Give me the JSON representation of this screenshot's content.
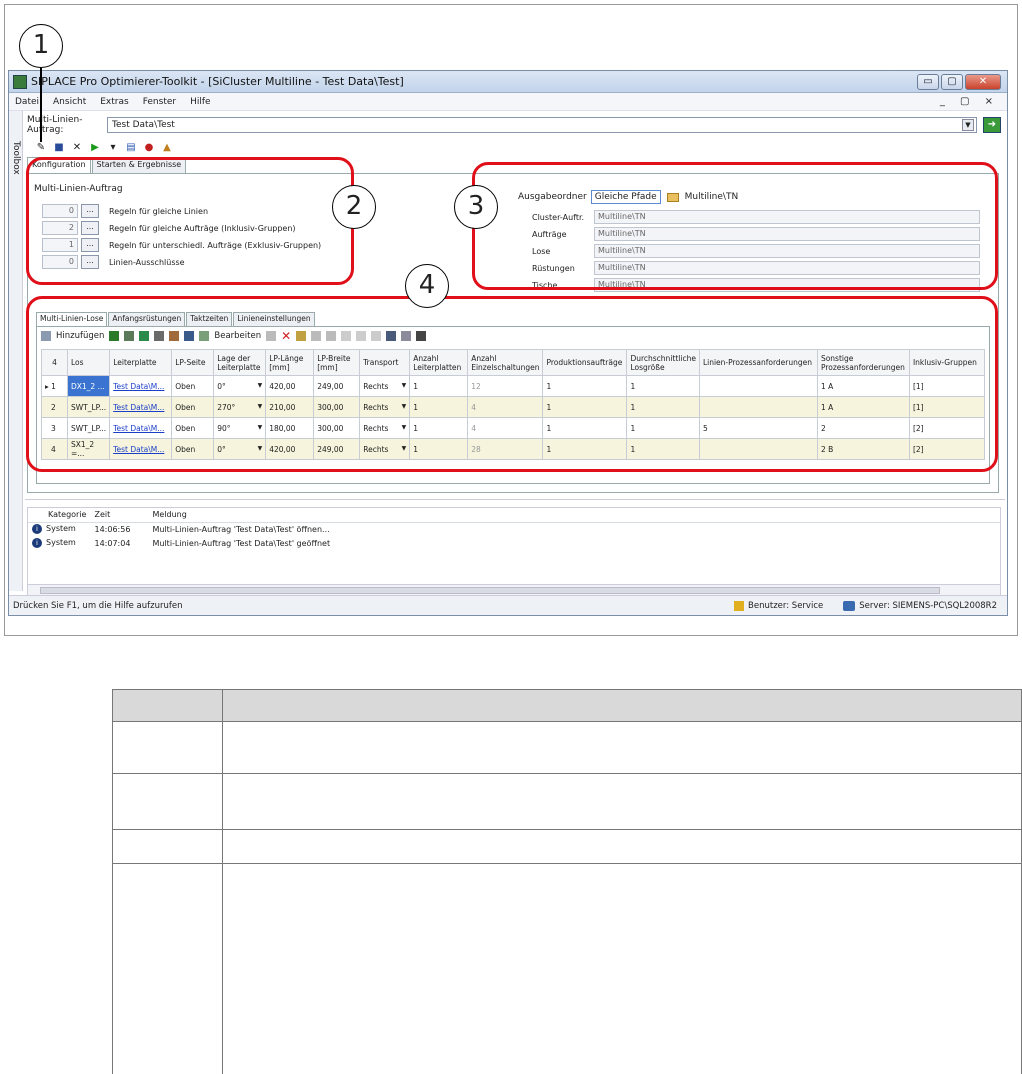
{
  "callouts": [
    "1",
    "2",
    "3",
    "4"
  ],
  "window": {
    "title": "SIPLACE Pro Optimierer-Toolkit - [SiCluster Multiline - Test Data\\Test]",
    "controls": {
      "minimize": "▭",
      "maximize": "▢",
      "close": "✕"
    }
  },
  "menu": {
    "items": [
      "Datei",
      "Ansicht",
      "Extras",
      "Fenster",
      "Hilfe"
    ],
    "mdi_controls": "_ ▢ ×"
  },
  "toolbox_label": "Toolbox",
  "multiline_job": {
    "label": "Multi-Linien-Auftrag:",
    "value": "Test Data\\Test"
  },
  "main_tabs": [
    "Konfiguration",
    "Starten & Ergebnisse"
  ],
  "config": {
    "section_title": "Multi-Linien-Auftrag",
    "rules": [
      {
        "count": "0",
        "label": "Regeln für gleiche Linien"
      },
      {
        "count": "2",
        "label": "Regeln für gleiche Aufträge (Inklusiv-Gruppen)"
      },
      {
        "count": "1",
        "label": "Regeln für unterschiedl. Aufträge (Exklusiv-Gruppen)"
      },
      {
        "count": "0",
        "label": "Linien-Ausschlüsse"
      }
    ],
    "dots_label": "...",
    "output": {
      "label": "Ausgabeordner",
      "button": "Gleiche Pfade",
      "path": "Multiline\\TN",
      "rows": [
        {
          "label": "Cluster-Auftr.",
          "value": "Multiline\\TN"
        },
        {
          "label": "Aufträge",
          "value": "Multiline\\TN"
        },
        {
          "label": "Lose",
          "value": "Multiline\\TN"
        },
        {
          "label": "Rüstungen",
          "value": "Multiline\\TN"
        },
        {
          "label": "Tische",
          "value": "Multiline\\TN"
        }
      ]
    }
  },
  "sub_tabs": [
    "Multi-Linien-Lose",
    "Anfangsrüstungen",
    "Taktzeiten",
    "Linieneinstellungen"
  ],
  "grid_toolbar": {
    "add": "Hinzufügen",
    "edit": "Bearbeiten"
  },
  "grid": {
    "headers": [
      "4",
      "Los",
      "Leiterplatte",
      "LP-Seite",
      "Lage der Leiterplatte",
      "LP-Länge [mm]",
      "LP-Breite [mm]",
      "Transport",
      "Anzahl Leiterplatten",
      "Anzahl Einzelschaltungen",
      "Produktionsaufträge",
      "Durchschnittliche Losgröße",
      "Linien-Prozessanforderungen",
      "Sonstige Prozessanforderungen",
      "Inklusiv-Gruppen"
    ],
    "rows": [
      [
        "1",
        "DX1_2 ...",
        "Test Data\\M...",
        "Oben",
        "0°",
        "420,00",
        "249,00",
        "Rechts",
        "1",
        "12",
        "1",
        "1",
        "",
        "1 A",
        "[1]"
      ],
      [
        "2",
        "SWT_LP...",
        "Test Data\\M...",
        "Oben",
        "270°",
        "210,00",
        "300,00",
        "Rechts",
        "1",
        "4",
        "1",
        "1",
        "",
        "1 A",
        "[1]"
      ],
      [
        "3",
        "SWT_LP...",
        "Test Data\\M...",
        "Oben",
        "90°",
        "180,00",
        "300,00",
        "Rechts",
        "1",
        "4",
        "1",
        "1",
        "5",
        "2",
        "[2]"
      ],
      [
        "4",
        "SX1_2 =...",
        "Test Data\\M...",
        "Oben",
        "0°",
        "420,00",
        "249,00",
        "Rechts",
        "1",
        "28",
        "1",
        "1",
        "",
        "2 B",
        "[2]"
      ]
    ]
  },
  "log": {
    "headers": [
      "Kategorie",
      "Zeit",
      "Meldung"
    ],
    "rows": [
      {
        "category": "System",
        "time": "14:06:56",
        "message": "Multi-Linien-Auftrag 'Test Data\\Test' öffnen..."
      },
      {
        "category": "System",
        "time": "14:07:04",
        "message": "Multi-Linien-Auftrag 'Test Data\\Test' geöffnet"
      }
    ]
  },
  "status": {
    "hint": "Drücken Sie F1, um die Hilfe aufzurufen",
    "user": "Benutzer: Service",
    "server": "Server: SIEMENS-PC\\SQL2008R2"
  }
}
